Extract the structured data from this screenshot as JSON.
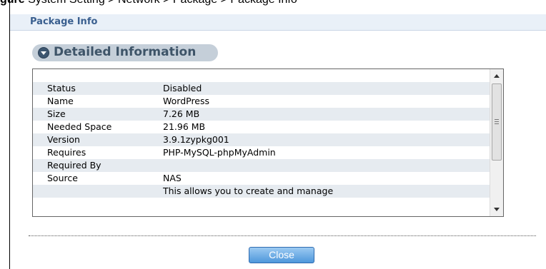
{
  "caption": {
    "prefix": "gure ",
    "text": "System Setting > Network > Package > Package Info"
  },
  "header": {
    "title": "Package Info"
  },
  "section": {
    "title": "Detailed Information"
  },
  "details": {
    "rows": [
      {
        "key": "",
        "value": ""
      },
      {
        "key": "Status",
        "value": "Disabled"
      },
      {
        "key": "Name",
        "value": "WordPress"
      },
      {
        "key": "Size",
        "value": "7.26 MB"
      },
      {
        "key": "Needed Space",
        "value": "21.96 MB"
      },
      {
        "key": "Version",
        "value": "3.9.1zypkg001"
      },
      {
        "key": "Requires",
        "value": "PHP-MySQL-phpMyAdmin"
      },
      {
        "key": "Required By",
        "value": ""
      },
      {
        "key": "Source",
        "value": "NAS"
      },
      {
        "key": "",
        "value": "This allows you to create and manage"
      }
    ]
  },
  "footer": {
    "close_label": "Close"
  },
  "colors": {
    "accent": "#3a5f8f",
    "header_bg": "#e9f0f8",
    "button": "#4e97db",
    "row_shade": "#e6ebf0"
  }
}
